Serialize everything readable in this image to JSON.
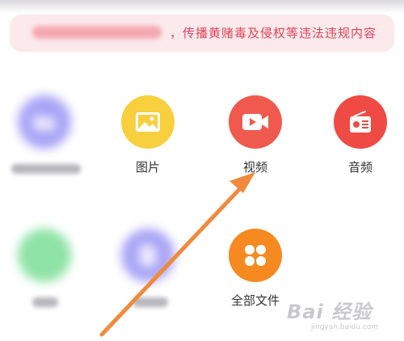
{
  "notice": {
    "text": "，传播黄赌毒及侵权等违法违规内容"
  },
  "grid": {
    "row1": [
      {
        "label": "",
        "icon": "folder-icon",
        "color": "#a9a4f6"
      },
      {
        "label": "图片",
        "icon": "image-icon",
        "color": "#f8cf3d"
      },
      {
        "label": "视频",
        "icon": "video-icon",
        "color": "#f05a4e"
      },
      {
        "label": "音频",
        "icon": "radio-icon",
        "color": "#ef4a43"
      }
    ],
    "row2": [
      {
        "label": "",
        "icon": "generic-icon",
        "color": "#8fe3a6"
      },
      {
        "label": "",
        "icon": "document-icon",
        "color": "#a9a4f6"
      },
      {
        "label": "全部文件",
        "icon": "grid-icon",
        "color": "#f6891f"
      }
    ]
  },
  "watermark": {
    "main": "Bai 经验",
    "sub": "jingyan.baidu.com"
  },
  "colors": {
    "accent_arrow": "#f08a3c",
    "notice_text": "#e0445a"
  }
}
